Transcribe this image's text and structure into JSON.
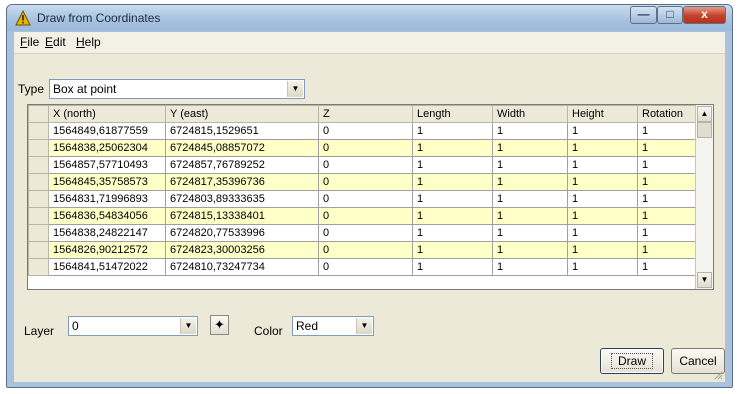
{
  "window": {
    "title": "Draw from Coordinates",
    "min_glyph": "—",
    "max_glyph": "□",
    "close_glyph": "x",
    "icon": "warning-triangle-icon"
  },
  "menu": [
    {
      "key": "F",
      "rest": "ile"
    },
    {
      "key": "E",
      "rest": "dit"
    },
    {
      "key": "H",
      "rest": "elp"
    }
  ],
  "type": {
    "label": "Type",
    "value": "Box at point"
  },
  "grid": {
    "columns": [
      "X (north)",
      "Y (east)",
      "Z",
      "Length",
      "Width",
      "Height",
      "Rotation"
    ],
    "rows": [
      [
        "1564849,61877559",
        "6724815,1529651",
        "0",
        "1",
        "1",
        "1",
        "1"
      ],
      [
        "1564838,25062304",
        "6724845,08857072",
        "0",
        "1",
        "1",
        "1",
        "1"
      ],
      [
        "1564857,57710493",
        "6724857,76789252",
        "0",
        "1",
        "1",
        "1",
        "1"
      ],
      [
        "1564845,35758573",
        "6724817,35396736",
        "0",
        "1",
        "1",
        "1",
        "1"
      ],
      [
        "1564831,71996893",
        "6724803,89333635",
        "0",
        "1",
        "1",
        "1",
        "1"
      ],
      [
        "1564836,54834056",
        "6724815,13338401",
        "0",
        "1",
        "1",
        "1",
        "1"
      ],
      [
        "1564838,24822147",
        "6724820,77533996",
        "0",
        "1",
        "1",
        "1",
        "1"
      ],
      [
        "1564826,90212572",
        "6724823,30003256",
        "0",
        "1",
        "1",
        "1",
        "1"
      ],
      [
        "1564841,51472022",
        "6724810,73247734",
        "0",
        "1",
        "1",
        "1",
        "1"
      ]
    ]
  },
  "layer": {
    "label": "Layer",
    "value": "0",
    "pick_glyph": "✦"
  },
  "color": {
    "label": "Color",
    "value": "Red"
  },
  "buttons": {
    "draw": "Draw",
    "cancel": "Cancel"
  },
  "colors": {
    "alt_row": "#ffffc8",
    "titlebar": "#a8c3e0",
    "close": "#c3412a"
  }
}
